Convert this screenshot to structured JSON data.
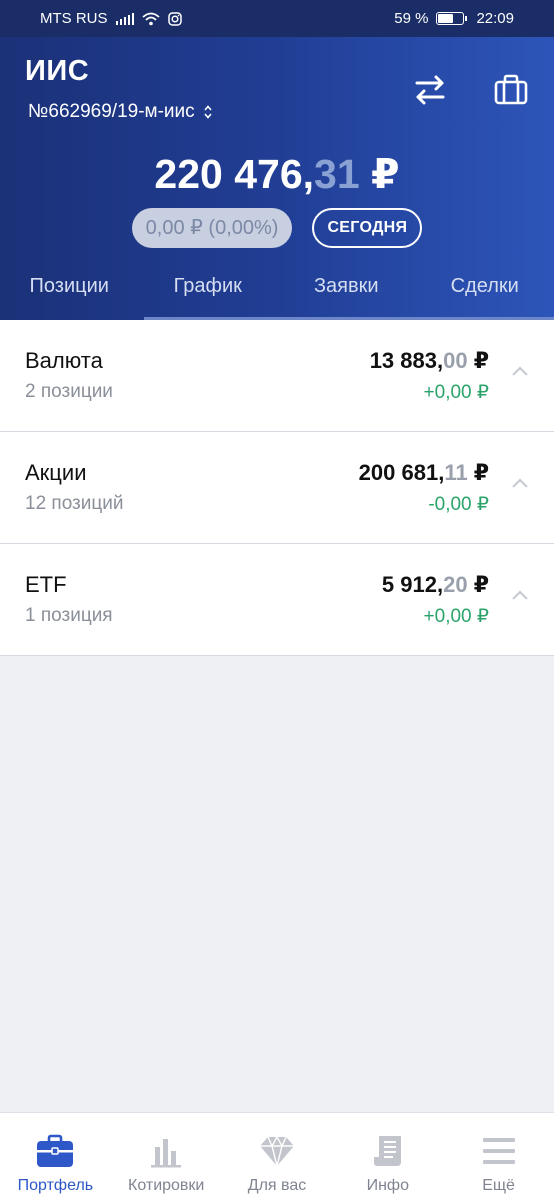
{
  "status_bar": {
    "carrier": "MTS RUS",
    "battery": "59 %",
    "time": "22:09"
  },
  "header": {
    "title": "ИИС",
    "account": "№662969/19-м-иис",
    "total_main": "220 476,",
    "total_fraction": "31",
    "total_currency": " ₽",
    "change": "0,00 ₽ (0,00%)",
    "period_button": "СЕГОДНЯ",
    "icons": [
      "swap-icon",
      "portfolio-icon"
    ]
  },
  "tabs": [
    {
      "label": "Позиции",
      "active": true
    },
    {
      "label": "График",
      "active": false
    },
    {
      "label": "Заявки",
      "active": false
    },
    {
      "label": "Сделки",
      "active": false
    }
  ],
  "groups": [
    {
      "name": "Валюта",
      "count": "2 позиции",
      "value_main": "13 883,",
      "value_fraction": "00",
      "currency": " ₽",
      "change": "+0,00 ₽"
    },
    {
      "name": "Акции",
      "count": "12 позиций",
      "value_main": "200 681,",
      "value_fraction": "11",
      "currency": " ₽",
      "change": "-0,00 ₽"
    },
    {
      "name": "ETF",
      "count": "1 позиция",
      "value_main": "5 912,",
      "value_fraction": "20",
      "currency": " ₽",
      "change": "+0,00 ₽"
    }
  ],
  "bottom_nav": [
    {
      "label": "Портфель",
      "icon": "briefcase-icon",
      "active": true
    },
    {
      "label": "Котировки",
      "icon": "bar-chart-icon",
      "active": false
    },
    {
      "label": "Для вас",
      "icon": "diamond-icon",
      "active": false
    },
    {
      "label": "Инфо",
      "icon": "document-icon",
      "active": false
    },
    {
      "label": "Ещё",
      "icon": "menu-icon",
      "active": false
    }
  ],
  "colors": {
    "header_start": "#1b3178",
    "header_end": "#2d55b9",
    "positive": "#2aa36a",
    "active_nav": "#2e58c8"
  }
}
